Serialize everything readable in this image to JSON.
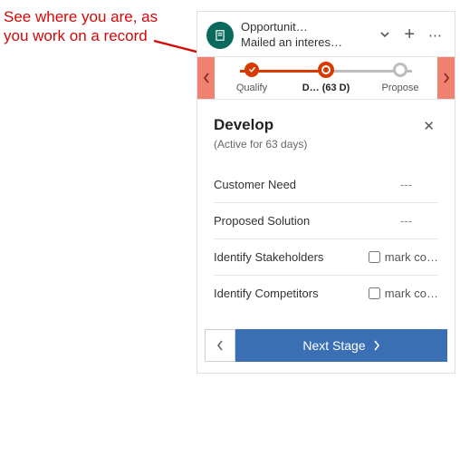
{
  "annotation": "See where you are, as you work on a record",
  "header": {
    "title": "Opportunit…",
    "subtitle": "Mailed an interes…"
  },
  "stages": {
    "items": [
      {
        "label": "Qualify"
      },
      {
        "label": "D…  (63 D)"
      },
      {
        "label": "Propose"
      }
    ]
  },
  "detail": {
    "title": "Develop",
    "subtitle": "(Active for 63 days)",
    "fields": [
      {
        "label": "Customer Need",
        "value": "---"
      },
      {
        "label": "Proposed Solution",
        "value": "---"
      },
      {
        "label": "Identify Stakeholders",
        "checkbox_label": "mark co…"
      },
      {
        "label": "Identify Competitors",
        "checkbox_label": "mark co…"
      }
    ]
  },
  "footer": {
    "next_label": "Next Stage"
  }
}
